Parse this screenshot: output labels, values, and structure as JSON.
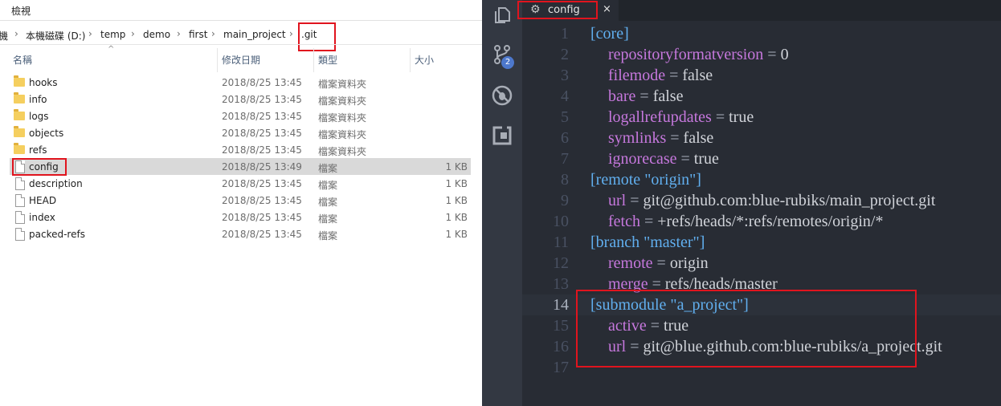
{
  "explorer": {
    "ribbon_tab": "檢視",
    "breadcrumb": [
      "機",
      "本機磁碟 (D:)",
      "temp",
      "demo",
      "first",
      "main_project",
      ".git"
    ],
    "columns": {
      "name": "名稱",
      "date": "修改日期",
      "type": "類型",
      "size": "大小"
    },
    "rows": [
      {
        "name": "hooks",
        "date": "2018/8/25 13:45",
        "type": "檔案資料夾",
        "size": ""
      },
      {
        "name": "info",
        "date": "2018/8/25 13:45",
        "type": "檔案資料夾",
        "size": ""
      },
      {
        "name": "logs",
        "date": "2018/8/25 13:45",
        "type": "檔案資料夾",
        "size": ""
      },
      {
        "name": "objects",
        "date": "2018/8/25 13:45",
        "type": "檔案資料夾",
        "size": ""
      },
      {
        "name": "refs",
        "date": "2018/8/25 13:45",
        "type": "檔案資料夾",
        "size": ""
      },
      {
        "name": "config",
        "date": "2018/8/25 13:49",
        "type": "檔案",
        "size": "1 KB"
      },
      {
        "name": "description",
        "date": "2018/8/25 13:45",
        "type": "檔案",
        "size": "1 KB"
      },
      {
        "name": "HEAD",
        "date": "2018/8/25 13:45",
        "type": "檔案",
        "size": "1 KB"
      },
      {
        "name": "index",
        "date": "2018/8/25 13:45",
        "type": "檔案",
        "size": "1 KB"
      },
      {
        "name": "packed-refs",
        "date": "2018/8/25 13:45",
        "type": "檔案",
        "size": "1 KB"
      }
    ]
  },
  "editor": {
    "tab_label": "config",
    "tab_close": "×",
    "scm_badge": "2",
    "lines": [
      {
        "n": "1",
        "section": "[core]"
      },
      {
        "n": "2",
        "key": "repositoryformatversion",
        "value": "0"
      },
      {
        "n": "3",
        "key": "filemode",
        "value": "false"
      },
      {
        "n": "4",
        "key": "bare",
        "value": "false"
      },
      {
        "n": "5",
        "key": "logallrefupdates",
        "value": "true"
      },
      {
        "n": "6",
        "key": "symlinks",
        "value": "false"
      },
      {
        "n": "7",
        "key": "ignorecase",
        "value": "true"
      },
      {
        "n": "8",
        "section": "[remote \"origin\"]"
      },
      {
        "n": "9",
        "key": "url",
        "value": "git@github.com:blue-rubiks/main_project.git"
      },
      {
        "n": "10",
        "key": "fetch",
        "value": "+refs/heads/*:refs/remotes/origin/*"
      },
      {
        "n": "11",
        "section": "[branch \"master\"]"
      },
      {
        "n": "12",
        "key": "remote",
        "value": "origin"
      },
      {
        "n": "13",
        "key": "merge",
        "value": "refs/heads/master"
      },
      {
        "n": "14",
        "section": "[submodule \"a_project\"]"
      },
      {
        "n": "15",
        "key": "active",
        "value": "true"
      },
      {
        "n": "16",
        "key": "url",
        "value": "git@blue.github.com:blue-rubiks/a_project.git"
      },
      {
        "n": "17"
      }
    ]
  }
}
